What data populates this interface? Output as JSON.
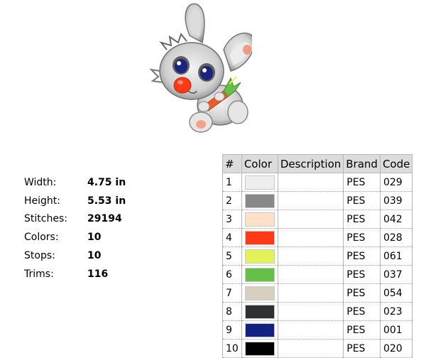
{
  "design": {
    "preview_icon": "bunny-with-carrot-embroidery"
  },
  "specs": [
    {
      "label": "Width:",
      "value": "4.75 in"
    },
    {
      "label": "Height:",
      "value": "5.53 in"
    },
    {
      "label": "Stitches:",
      "value": "29194"
    },
    {
      "label": "Colors:",
      "value": "10"
    },
    {
      "label": "Stops:",
      "value": "10"
    },
    {
      "label": "Trims:",
      "value": "116"
    }
  ],
  "table": {
    "headers": {
      "num": "#",
      "color": "Color",
      "description": "Description",
      "brand": "Brand",
      "code": "Code"
    },
    "rows": [
      {
        "num": "1",
        "color": "#eeeeee",
        "description": "",
        "brand": "PES",
        "code": "029"
      },
      {
        "num": "2",
        "color": "#888888",
        "description": "",
        "brand": "PES",
        "code": "039"
      },
      {
        "num": "3",
        "color": "#fde1c8",
        "description": "",
        "brand": "PES",
        "code": "042"
      },
      {
        "num": "4",
        "color": "#fd3a16",
        "description": "",
        "brand": "PES",
        "code": "028"
      },
      {
        "num": "5",
        "color": "#e3f25a",
        "description": "",
        "brand": "PES",
        "code": "061"
      },
      {
        "num": "6",
        "color": "#66bf47",
        "description": "",
        "brand": "PES",
        "code": "037"
      },
      {
        "num": "7",
        "color": "#d8cfc1",
        "description": "",
        "brand": "PES",
        "code": "054"
      },
      {
        "num": "8",
        "color": "#2e3133",
        "description": "",
        "brand": "PES",
        "code": "023"
      },
      {
        "num": "9",
        "color": "#13217f",
        "description": "",
        "brand": "PES",
        "code": "001"
      },
      {
        "num": "10",
        "color": "#000000",
        "description": "",
        "brand": "PES",
        "code": "020"
      }
    ]
  }
}
